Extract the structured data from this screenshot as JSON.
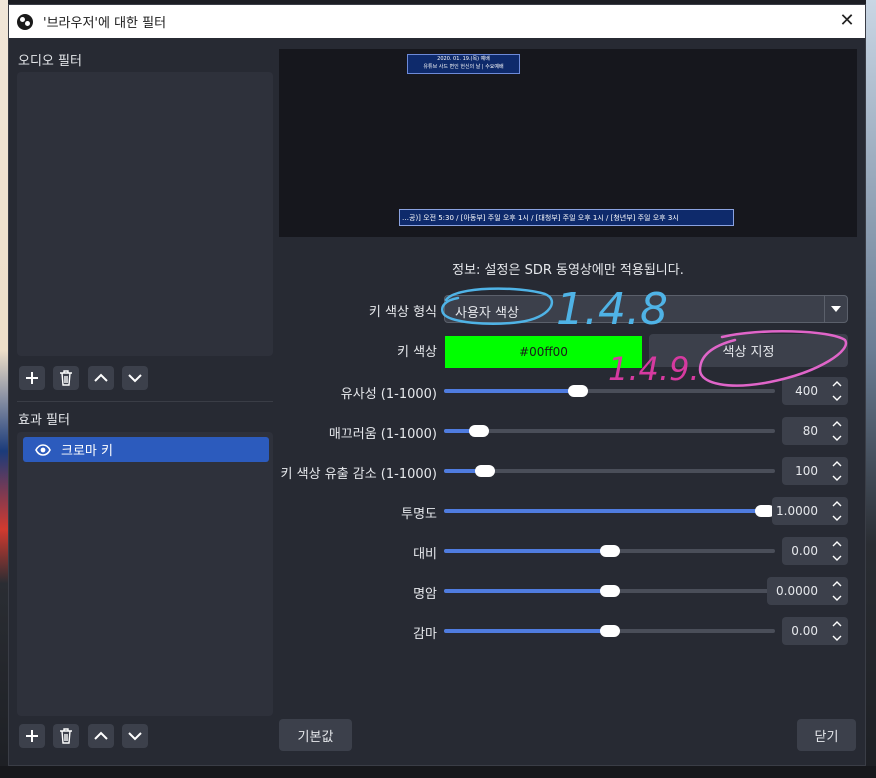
{
  "window": {
    "title": "'브라우저'에 대한 필터",
    "close_label": "✕"
  },
  "audio_filters": {
    "label": "오디오 필터"
  },
  "effect_filters": {
    "label": "효과 필터",
    "items": [
      {
        "label": "크로마 키"
      }
    ]
  },
  "preview": {
    "overlay_top_lines": [
      "2020. 01. 19.(목) 예배",
      "유튜브 사드 변인 헌신의 날 | 수요예배"
    ],
    "overlay_bottom_text": "…공)] 오전 5:30 / [아동부] 주일 오후 1시 / [대청부] 주일 오후 1시 / [청년부] 주일 오후 3시"
  },
  "info_text": "정보: 설정은 SDR 동영상에만 적용됩니다.",
  "key_color_type": {
    "label": "키 색상 형식",
    "value": "사용자 색상"
  },
  "key_color": {
    "label": "키 색상",
    "value": "#00ff00",
    "select_button": "색상 지정",
    "swatch_color": "#00ff00"
  },
  "sliders": [
    {
      "label": "유사성 (1-1000)",
      "value": "400",
      "fraction": 0.4
    },
    {
      "label": "매끄러움 (1-1000)",
      "value": "80",
      "fraction": 0.079
    },
    {
      "label": "키 색상 유출 감소 (1-1000)",
      "value": "100",
      "fraction": 0.099
    },
    {
      "label": "투명도",
      "value": "1.0000",
      "fraction": 1.0
    },
    {
      "label": "대비",
      "value": "0.00",
      "fraction": 0.5
    },
    {
      "label": "명암",
      "value": "0.0000",
      "fraction": 0.5
    },
    {
      "label": "감마",
      "value": "0.00",
      "fraction": 0.5
    }
  ],
  "buttons": {
    "defaults": "기본값",
    "close": "닫기"
  },
  "annotations": {
    "blue": "1.4.8",
    "magenta": "1.4.9."
  },
  "colors": {
    "accent": "#4f7ce0",
    "selection": "#2c5bbd",
    "annot_blue": "#4fb3e6",
    "annot_magenta": "#d63aa0"
  }
}
